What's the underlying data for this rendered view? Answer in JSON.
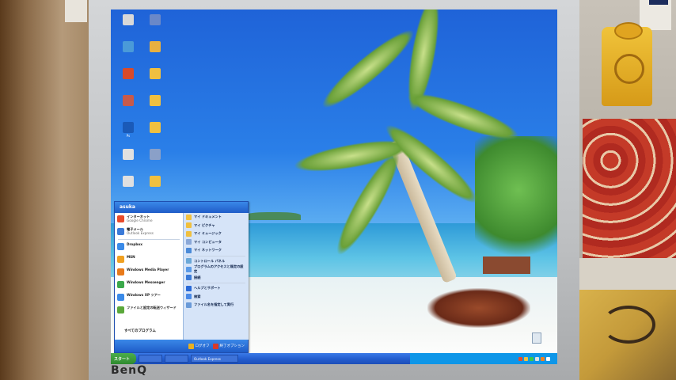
{
  "monitor": {
    "brand": "BenQ"
  },
  "desktop_icons": [
    {
      "label": "",
      "color": "#d8d8d8"
    },
    {
      "label": "",
      "color": "#6a88c8"
    },
    {
      "label": "",
      "color": "#4a9ad8"
    },
    {
      "label": "",
      "color": "#e8b040"
    },
    {
      "label": "",
      "color": "#d84a2a"
    },
    {
      "label": "",
      "color": "#f0c040"
    },
    {
      "label": "",
      "color": "#c85a4a"
    },
    {
      "label": "",
      "color": "#f0c040"
    },
    {
      "label": "Ps",
      "color": "#1a5ab8"
    },
    {
      "label": "",
      "color": "#f0c040"
    },
    {
      "label": "",
      "color": "#e0e0e0"
    },
    {
      "label": "",
      "color": "#8aa0c8"
    },
    {
      "label": "",
      "color": "#e0e0e0"
    },
    {
      "label": "",
      "color": "#f0c040"
    }
  ],
  "start_menu": {
    "user": "asuka",
    "pinned": [
      {
        "main": "インターネット",
        "sub": "Google Chrome",
        "color": "#e84a2a"
      },
      {
        "main": "電子メール",
        "sub": "Outlook Express",
        "color": "#3a7ad8"
      }
    ],
    "recent": [
      {
        "main": "Dropbox",
        "color": "#3a8ae8"
      },
      {
        "main": "MSN",
        "color": "#f0a020"
      },
      {
        "main": "Windows Media Player",
        "color": "#e87a1a"
      },
      {
        "main": "Windows Messenger",
        "color": "#3aa84a"
      },
      {
        "main": "Windows XP ツアー",
        "color": "#3a8ae8"
      },
      {
        "main": "ファイルと設定の転送ウィザード",
        "color": "#5aa83a"
      }
    ],
    "all_programs": "すべてのプログラム",
    "right_items": [
      {
        "label": "マイ ドキュメント",
        "color": "#f0c040"
      },
      {
        "label": "マイ ピクチャ",
        "color": "#f0c040"
      },
      {
        "label": "マイ ミュージック",
        "color": "#f0c040"
      },
      {
        "label": "マイ コンピュータ",
        "color": "#8aa8d8"
      },
      {
        "label": "マイ ネットワーク",
        "color": "#4a8ad8"
      },
      {
        "label": "コントロール パネル",
        "color": "#6aa8d8"
      },
      {
        "label": "プログラムのアクセスと既定の設定",
        "color": "#5a9ae8"
      },
      {
        "label": "接続",
        "color": "#3a7ad8"
      },
      {
        "label": "ヘルプとサポート",
        "color": "#2a6ad8"
      },
      {
        "label": "検索",
        "color": "#4a8ae8"
      },
      {
        "label": "ファイル名を指定して実行",
        "color": "#6a9ad8"
      }
    ],
    "logoff": "ログオフ",
    "shutdown": "終了オプション"
  },
  "taskbar": {
    "start": "スタート",
    "buttons": [
      "",
      "",
      "Outlook Express"
    ],
    "clock": ""
  },
  "recycle_bin": {
    "label": ""
  }
}
